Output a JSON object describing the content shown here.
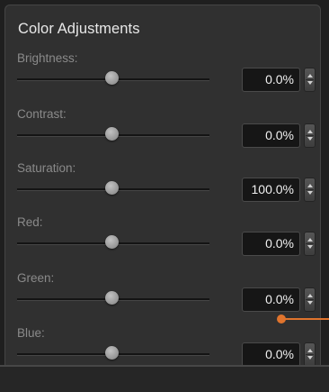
{
  "panel": {
    "title": "Color Adjustments"
  },
  "rows": [
    {
      "label": "Brightness:",
      "value": "0.0%",
      "slider_fraction": 0.5
    },
    {
      "label": "Contrast:",
      "value": "0.0%",
      "slider_fraction": 0.5
    },
    {
      "label": "Saturation:",
      "value": "100.0%",
      "slider_fraction": 0.5
    },
    {
      "label": "Red:",
      "value": "0.0%",
      "slider_fraction": 0.5
    },
    {
      "label": "Green:",
      "value": "0.0%",
      "slider_fraction": 0.5
    },
    {
      "label": "Blue:",
      "value": "0.0%",
      "slider_fraction": 0.5
    }
  ],
  "icons": {
    "stepper": "up-down-stepper-icon",
    "callout": "callout-pointer"
  },
  "colors": {
    "panel_background": "#303030",
    "value_field": "#161616",
    "callout_accent": "#e0742d"
  }
}
